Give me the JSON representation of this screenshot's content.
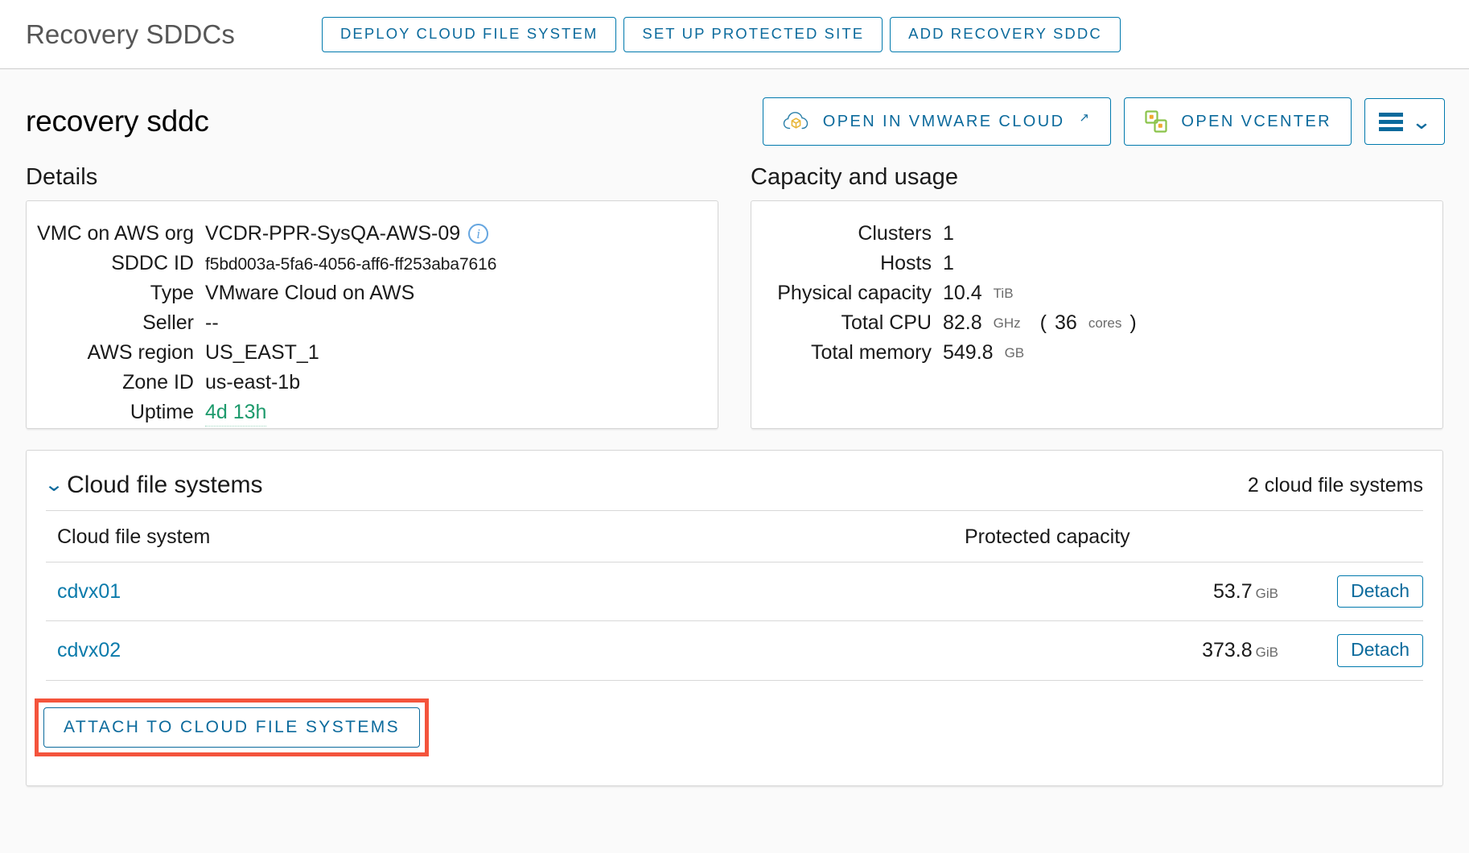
{
  "topbar": {
    "title": "Recovery SDDCs",
    "buttons": [
      {
        "label": "DEPLOY CLOUD FILE SYSTEM"
      },
      {
        "label": "SET UP PROTECTED SITE"
      },
      {
        "label": "ADD RECOVERY SDDC"
      }
    ]
  },
  "subheader": {
    "sddc_name": "recovery sddc",
    "open_cloud_label": "OPEN IN VMWARE CLOUD",
    "open_cloud_external_glyph": "↗",
    "open_vcenter_label": "OPEN VCENTER",
    "menu_icon": "hamburger-icon",
    "menu_caret": "⌄"
  },
  "details": {
    "title": "Details",
    "rows": [
      {
        "label": "VMC on AWS org",
        "value": "VCDR-PPR-SysQA-AWS-09",
        "info": true
      },
      {
        "label": "SDDC ID",
        "value": "f5bd003a-5fa6-4056-aff6-ff253aba7616",
        "small": true
      },
      {
        "label": "Type",
        "value": "VMware Cloud on AWS"
      },
      {
        "label": "Seller",
        "value": "--"
      },
      {
        "label": "AWS region",
        "value": "US_EAST_1"
      },
      {
        "label": "Zone ID",
        "value": "us-east-1b"
      },
      {
        "label": "Uptime",
        "value": "4d 13h",
        "accent": "#1d9a6c"
      }
    ]
  },
  "capacity": {
    "title": "Capacity and usage",
    "rows": [
      {
        "label": "Clusters",
        "value": "1",
        "unit": ""
      },
      {
        "label": "Hosts",
        "value": "1",
        "unit": ""
      },
      {
        "label": "Physical capacity",
        "value": "10.4",
        "unit": "TiB"
      },
      {
        "label": "Total CPU",
        "value": "82.8",
        "unit": "GHz",
        "extra_open": "(",
        "extra_value": "36",
        "extra_unit": "cores",
        "extra_close": ")"
      },
      {
        "label": "Total memory",
        "value": "549.8",
        "unit": "GB"
      }
    ]
  },
  "cloud_file_systems": {
    "title": "Cloud file systems",
    "count_label": "2 cloud file systems",
    "columns": {
      "name": "Cloud file system",
      "capacity": "Protected capacity",
      "actions": ""
    },
    "rows": [
      {
        "name": "cdvx01",
        "capacity": "53.7",
        "unit": "GiB",
        "action": "Detach"
      },
      {
        "name": "cdvx02",
        "capacity": "373.8",
        "unit": "GiB",
        "action": "Detach"
      }
    ],
    "attach_label": "ATTACH TO CLOUD FILE SYSTEMS",
    "highlight_color": "#f4543c"
  },
  "colors": {
    "link": "#0b7bab",
    "button_border": "#0079ad",
    "page_bg": "#fafafa",
    "uptime_green": "#1d9a6c",
    "info_blue": "#66a6e0",
    "vcenter_green": "#8bc34a",
    "vcenter_orange": "#f0a830",
    "cloud_icon_gold": "#e8b63a"
  }
}
